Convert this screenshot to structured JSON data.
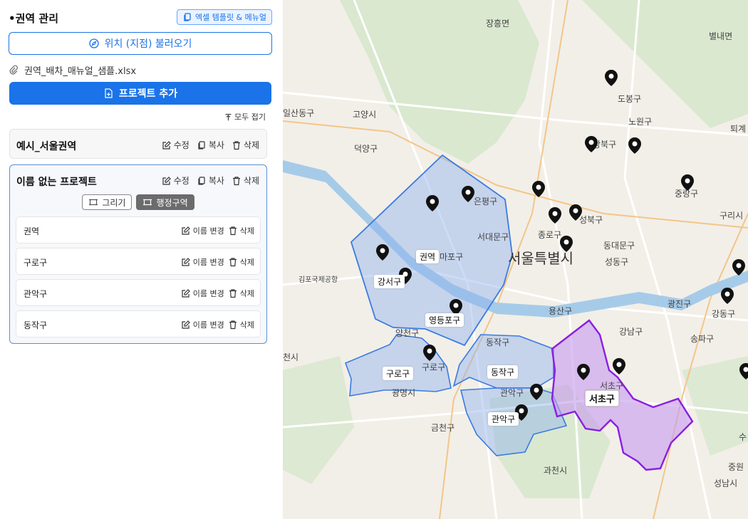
{
  "sidebar": {
    "title": "•권역 관리",
    "template_button": "엑셀 템플릿 & 메뉴얼",
    "load_location_button": "위치 (지점) 불러오기",
    "file_name": "권역_배차_매뉴얼_샘플.xlsx",
    "add_project_button": "프로젝트 추가",
    "collapse_all": "모두 접기",
    "projects": [
      {
        "name": "예시_서울권역",
        "edit": "수정",
        "copy": "복사",
        "delete": "삭제"
      },
      {
        "name": "이름 없는 프로젝트",
        "edit": "수정",
        "copy": "복사",
        "delete": "삭제",
        "mode_draw": "그리기",
        "mode_admin": "행정구역",
        "regions": [
          {
            "name": "권역",
            "rename": "이름 변경",
            "delete": "삭제"
          },
          {
            "name": "구로구",
            "rename": "이름 변경",
            "delete": "삭제"
          },
          {
            "name": "관악구",
            "rename": "이름 변경",
            "delete": "삭제"
          },
          {
            "name": "동작구",
            "rename": "이름 변경",
            "delete": "삭제"
          }
        ]
      }
    ]
  },
  "map": {
    "labels": {
      "jangheung": "장흥면",
      "byeollae": "별내면",
      "dobong": "도봉구",
      "nowon": "노원구",
      "ilsandong": "일산동구",
      "goyang": "고양시",
      "toegye": "퇴계",
      "gangbuk": "강북구",
      "deogyang": "덕양구",
      "jungnang": "중랑구",
      "eunpyeong": "은평구",
      "seongbuk": "성북구",
      "guri": "구리시",
      "seodaemun": "서대문구",
      "jongno": "종로구",
      "dongdaemun": "동대문구",
      "mapo": "마포구",
      "seoul": "서울특별시",
      "seongdong": "성동구",
      "gimpo_airport": "김포국제공항",
      "gangseo": "강서구",
      "gwangjin": "광진구",
      "gangdong": "강동구",
      "yongsan": "용산구",
      "yeongdeungpo": "영등포구",
      "yangcheon": "양천구",
      "gangnam": "강남구",
      "songpa": "송파구",
      "dongjak": "동작구",
      "bucheon": "천시",
      "guro": "구로구",
      "seocho": "서초구",
      "gwanak": "관악구",
      "gwangmyeong": "광명시",
      "geumcheon": "금천구",
      "gwacheon": "과천시",
      "jungwon": "중원",
      "seongnam": "성남시",
      "su": "수"
    },
    "tags": {
      "region": "권역",
      "gangseo": "강서구",
      "yeongdeungpo": "영등포구",
      "guro_a": "구로구",
      "guro_b": "구로구",
      "dongjak": "동작구",
      "gwanak": "관악구",
      "seocho": "서초구"
    },
    "colors": {
      "blue_fill": "#8fb2ef",
      "blue_stroke": "#3b7be0",
      "purple_fill": "#c79af0",
      "purple_stroke": "#8a1ee0"
    }
  }
}
